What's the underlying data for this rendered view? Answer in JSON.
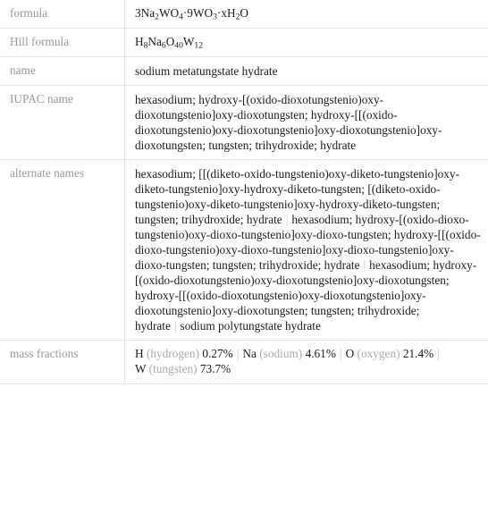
{
  "table": {
    "rows": [
      {
        "label": "formula",
        "type": "formula",
        "value_plain": "3Na2WO4·9WO3·xH2O",
        "parts": [
          {
            "t": "3Na",
            "sub": "2"
          },
          {
            "t": "WO",
            "sub": "4"
          },
          {
            "t": "·9WO",
            "sub": "3"
          },
          {
            "t": "·xH",
            "sub": "2"
          },
          {
            "t": "O",
            "sub": ""
          }
        ]
      },
      {
        "label": "Hill formula",
        "type": "formula",
        "value_plain": "H8Na6O40W12",
        "parts": [
          {
            "t": "H",
            "sub": "8"
          },
          {
            "t": "Na",
            "sub": "6"
          },
          {
            "t": "O",
            "sub": "40"
          },
          {
            "t": "W",
            "sub": "12"
          }
        ]
      },
      {
        "label": "name",
        "type": "text",
        "value": "sodium metatungstate hydrate"
      },
      {
        "label": "IUPAC name",
        "type": "text",
        "value": "hexasodium; hydroxy-[(oxido-dioxotungstenio)oxy-dioxotungstenio]oxy-dioxotungsten; hydroxy-[[(oxido-dioxotungstenio)oxy-dioxotungstenio]oxy-dioxotungstenio]oxy-dioxotungsten; tungsten; trihydroxide; hydrate"
      },
      {
        "label": "alternate names",
        "type": "alternates",
        "items": [
          "hexasodium; [[(diketo-oxido-tungstenio)oxy-diketo-tungstenio]oxy-diketo-tungstenio]oxy-hydroxy-diketo-tungsten; [(diketo-oxido-tungstenio)oxy-diketo-tungstenio]oxy-hydroxy-diketo-tungsten; tungsten; trihydroxide; hydrate",
          "hexasodium; hydroxy-[(oxido-dioxo-tungstenio)oxy-dioxo-tungstenio]oxy-dioxo-tungsten; hydroxy-[[(oxido-dioxo-tungstenio)oxy-dioxo-tungstenio]oxy-dioxo-tungstenio]oxy-dioxo-tungsten; tungsten; trihydroxide; hydrate",
          "hexasodium; hydroxy-[(oxido-dioxotungstenio)oxy-dioxotungstenio]oxy-dioxotungsten; hydroxy-[[(oxido-dioxotungstenio)oxy-dioxotungstenio]oxy-dioxotungstenio]oxy-dioxotungsten; tungsten; trihydroxide; hydrate",
          "sodium polytungstate hydrate"
        ],
        "separator": "|"
      },
      {
        "label": "mass fractions",
        "type": "mass_fractions",
        "separator": "|",
        "entries": [
          {
            "symbol": "H",
            "name": "(hydrogen)",
            "value": "0.27%"
          },
          {
            "symbol": "Na",
            "name": "(sodium)",
            "value": "4.61%"
          },
          {
            "symbol": "O",
            "name": "(oxygen)",
            "value": "21.4%"
          },
          {
            "symbol": "W",
            "name": "(tungsten)",
            "value": "73.7%"
          }
        ]
      }
    ]
  },
  "colors": {
    "border": "#e3e3e3",
    "label_text": "#999999",
    "value_text": "#1a1a1a",
    "muted_text": "#aaaaaa",
    "separator": "#c4c4c4",
    "background": "#ffffff"
  }
}
